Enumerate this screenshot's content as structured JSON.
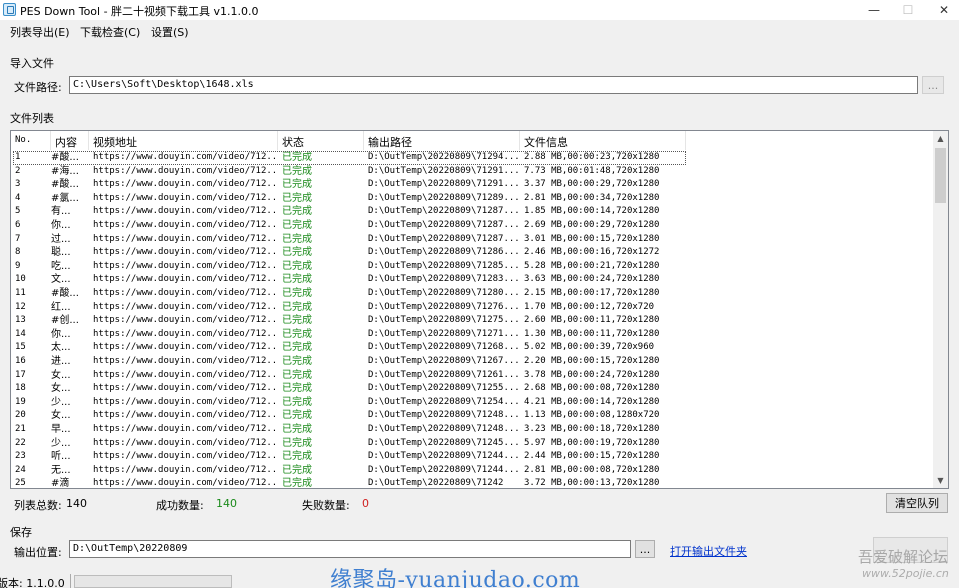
{
  "window": {
    "title": "PES Down Tool - 胖二十视频下载工具 v1.1.0.0",
    "minimize_glyph": "—",
    "maximize_glyph": "☐",
    "close_glyph": "✕"
  },
  "menu": [
    "列表导出(E)",
    "下载检查(C)",
    "设置(S)"
  ],
  "import_group": {
    "title": "导入文件",
    "path_label": "文件路径:",
    "path_value": "C:\\Users\\Soft\\Desktop\\1648.xls",
    "browse_label": "..."
  },
  "list_group": {
    "title": "文件列表",
    "columns": [
      "No.",
      "内容",
      "视频地址",
      "状态",
      "输出路径",
      "文件信息"
    ],
    "rows": [
      [
        "1",
        "#酸...",
        "https://www.douyin.com/video/712...",
        "已完成",
        "D:\\OutTemp\\20220809\\71294...",
        "2.88 MB,00:00:23,720x1280"
      ],
      [
        "2",
        "#海...",
        "https://www.douyin.com/video/712...",
        "已完成",
        "D:\\OutTemp\\20220809\\71291...",
        "7.73 MB,00:01:48,720x1280"
      ],
      [
        "3",
        "#酸...",
        "https://www.douyin.com/video/712...",
        "已完成",
        "D:\\OutTemp\\20220809\\71291...",
        "3.37 MB,00:00:29,720x1280"
      ],
      [
        "4",
        "#氯...",
        "https://www.douyin.com/video/712...",
        "已完成",
        "D:\\OutTemp\\20220809\\71289...",
        "2.81 MB,00:00:34,720x1280"
      ],
      [
        "5",
        "有...",
        "https://www.douyin.com/video/712...",
        "已完成",
        "D:\\OutTemp\\20220809\\71287...",
        "1.85 MB,00:00:14,720x1280"
      ],
      [
        "6",
        "你...",
        "https://www.douyin.com/video/712...",
        "已完成",
        "D:\\OutTemp\\20220809\\71287...",
        "2.69 MB,00:00:29,720x1280"
      ],
      [
        "7",
        "过...",
        "https://www.douyin.com/video/712...",
        "已完成",
        "D:\\OutTemp\\20220809\\71287...",
        "3.01 MB,00:00:15,720x1280"
      ],
      [
        "8",
        "聪...",
        "https://www.douyin.com/video/712...",
        "已完成",
        "D:\\OutTemp\\20220809\\71286...",
        "2.46 MB,00:00:16,720x1272"
      ],
      [
        "9",
        "吃...",
        "https://www.douyin.com/video/712...",
        "已完成",
        "D:\\OutTemp\\20220809\\71285...",
        "5.28 MB,00:00:21,720x1280"
      ],
      [
        "10",
        "文...",
        "https://www.douyin.com/video/712...",
        "已完成",
        "D:\\OutTemp\\20220809\\71283...",
        "3.63 MB,00:00:24,720x1280"
      ],
      [
        "11",
        "#酸...",
        "https://www.douyin.com/video/712...",
        "已完成",
        "D:\\OutTemp\\20220809\\71280...",
        "2.15 MB,00:00:17,720x1280"
      ],
      [
        "12",
        "红...",
        "https://www.douyin.com/video/712...",
        "已完成",
        "D:\\OutTemp\\20220809\\71276...",
        "1.70 MB,00:00:12,720x720"
      ],
      [
        "13",
        "#创...",
        "https://www.douyin.com/video/712...",
        "已完成",
        "D:\\OutTemp\\20220809\\71275...",
        "2.60 MB,00:00:11,720x1280"
      ],
      [
        "14",
        "你...",
        "https://www.douyin.com/video/712...",
        "已完成",
        "D:\\OutTemp\\20220809\\71271...",
        "1.30 MB,00:00:11,720x1280"
      ],
      [
        "15",
        "太...",
        "https://www.douyin.com/video/712...",
        "已完成",
        "D:\\OutTemp\\20220809\\71268...",
        "5.02 MB,00:00:39,720x960"
      ],
      [
        "16",
        "进...",
        "https://www.douyin.com/video/712...",
        "已完成",
        "D:\\OutTemp\\20220809\\71267...",
        "2.20 MB,00:00:15,720x1280"
      ],
      [
        "17",
        "女...",
        "https://www.douyin.com/video/712...",
        "已完成",
        "D:\\OutTemp\\20220809\\71261...",
        "3.78 MB,00:00:24,720x1280"
      ],
      [
        "18",
        "女...",
        "https://www.douyin.com/video/712...",
        "已完成",
        "D:\\OutTemp\\20220809\\71255...",
        "2.68 MB,00:00:08,720x1280"
      ],
      [
        "19",
        "少...",
        "https://www.douyin.com/video/712...",
        "已完成",
        "D:\\OutTemp\\20220809\\71254...",
        "4.21 MB,00:00:14,720x1280"
      ],
      [
        "20",
        "女...",
        "https://www.douyin.com/video/712...",
        "已完成",
        "D:\\OutTemp\\20220809\\71248...",
        "1.13 MB,00:00:08,1280x720"
      ],
      [
        "21",
        "早...",
        "https://www.douyin.com/video/712...",
        "已完成",
        "D:\\OutTemp\\20220809\\71248...",
        "3.23 MB,00:00:18,720x1280"
      ],
      [
        "22",
        "少...",
        "https://www.douyin.com/video/712...",
        "已完成",
        "D:\\OutTemp\\20220809\\71245...",
        "5.97 MB,00:00:19,720x1280"
      ],
      [
        "23",
        "听...",
        "https://www.douyin.com/video/712...",
        "已完成",
        "D:\\OutTemp\\20220809\\71244...",
        "2.44 MB,00:00:15,720x1280"
      ],
      [
        "24",
        "无...",
        "https://www.douyin.com/video/712...",
        "已完成",
        "D:\\OutTemp\\20220809\\71244...",
        "2.81 MB,00:00:08,720x1280"
      ],
      [
        "25",
        "#滴",
        "https://www.douyin.com/video/712...",
        "已完成",
        "D:\\OutTemp\\20220809\\71242",
        "3.72 MB,00:00:13,720x1280"
      ]
    ]
  },
  "stats": {
    "total_label": "列表总数:",
    "total_value": "140",
    "success_label": "成功数量:",
    "success_value": "140",
    "fail_label": "失败数量:",
    "fail_value": "0",
    "clear_button": "清空队列"
  },
  "save_group": {
    "title": "保存",
    "output_label": "输出位置:",
    "output_value": "D:\\OutTemp\\20220809",
    "browse_label": "...",
    "open_link": "打开输出文件夹"
  },
  "statusbar": {
    "version": "版本: 1.1.0.0"
  },
  "watermarks": {
    "center": "缘聚岛-yuanjudao.com",
    "right_top": "吾爱破解论坛",
    "right_bottom": "www.52pojie.cn"
  },
  "colors": {
    "status_done": "#1a8a1a",
    "fail_count": "#d02020",
    "link": "#0033cc"
  }
}
